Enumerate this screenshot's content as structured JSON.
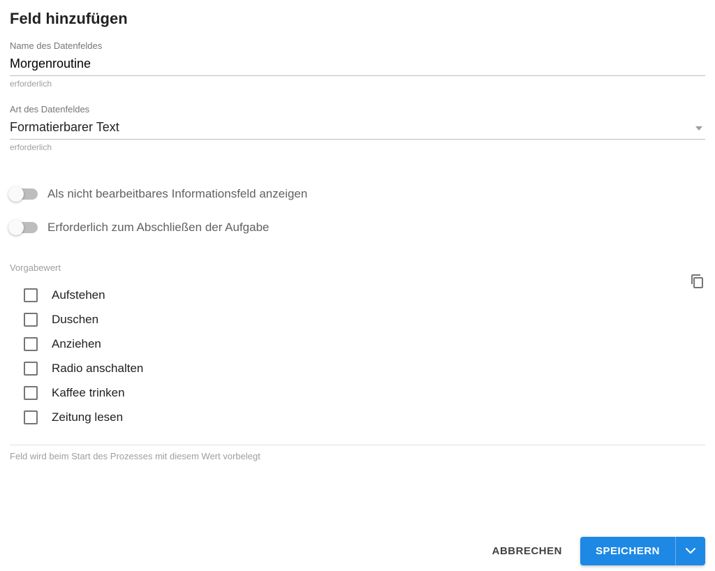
{
  "title": "Feld hinzufügen",
  "name_field": {
    "label": "Name des Datenfeldes",
    "value": "Morgenroutine",
    "helper": "erforderlich"
  },
  "type_field": {
    "label": "Art des Datenfeldes",
    "value": "Formatierbarer Text",
    "helper": "erforderlich"
  },
  "toggles": {
    "readonly_label": "Als nicht bearbeitbares Informationsfeld anzeigen",
    "required_label": "Erforderlich zum Abschließen der Aufgabe"
  },
  "default_section": {
    "label": "Vorgabewert",
    "items": [
      "Aufstehen",
      "Duschen",
      "Anziehen",
      "Radio anschalten",
      "Kaffee trinken",
      "Zeitung lesen"
    ],
    "helper": "Feld wird beim Start des Prozesses mit diesem Wert vorbelegt"
  },
  "footer": {
    "cancel": "Abbrechen",
    "save": "Speichern"
  }
}
